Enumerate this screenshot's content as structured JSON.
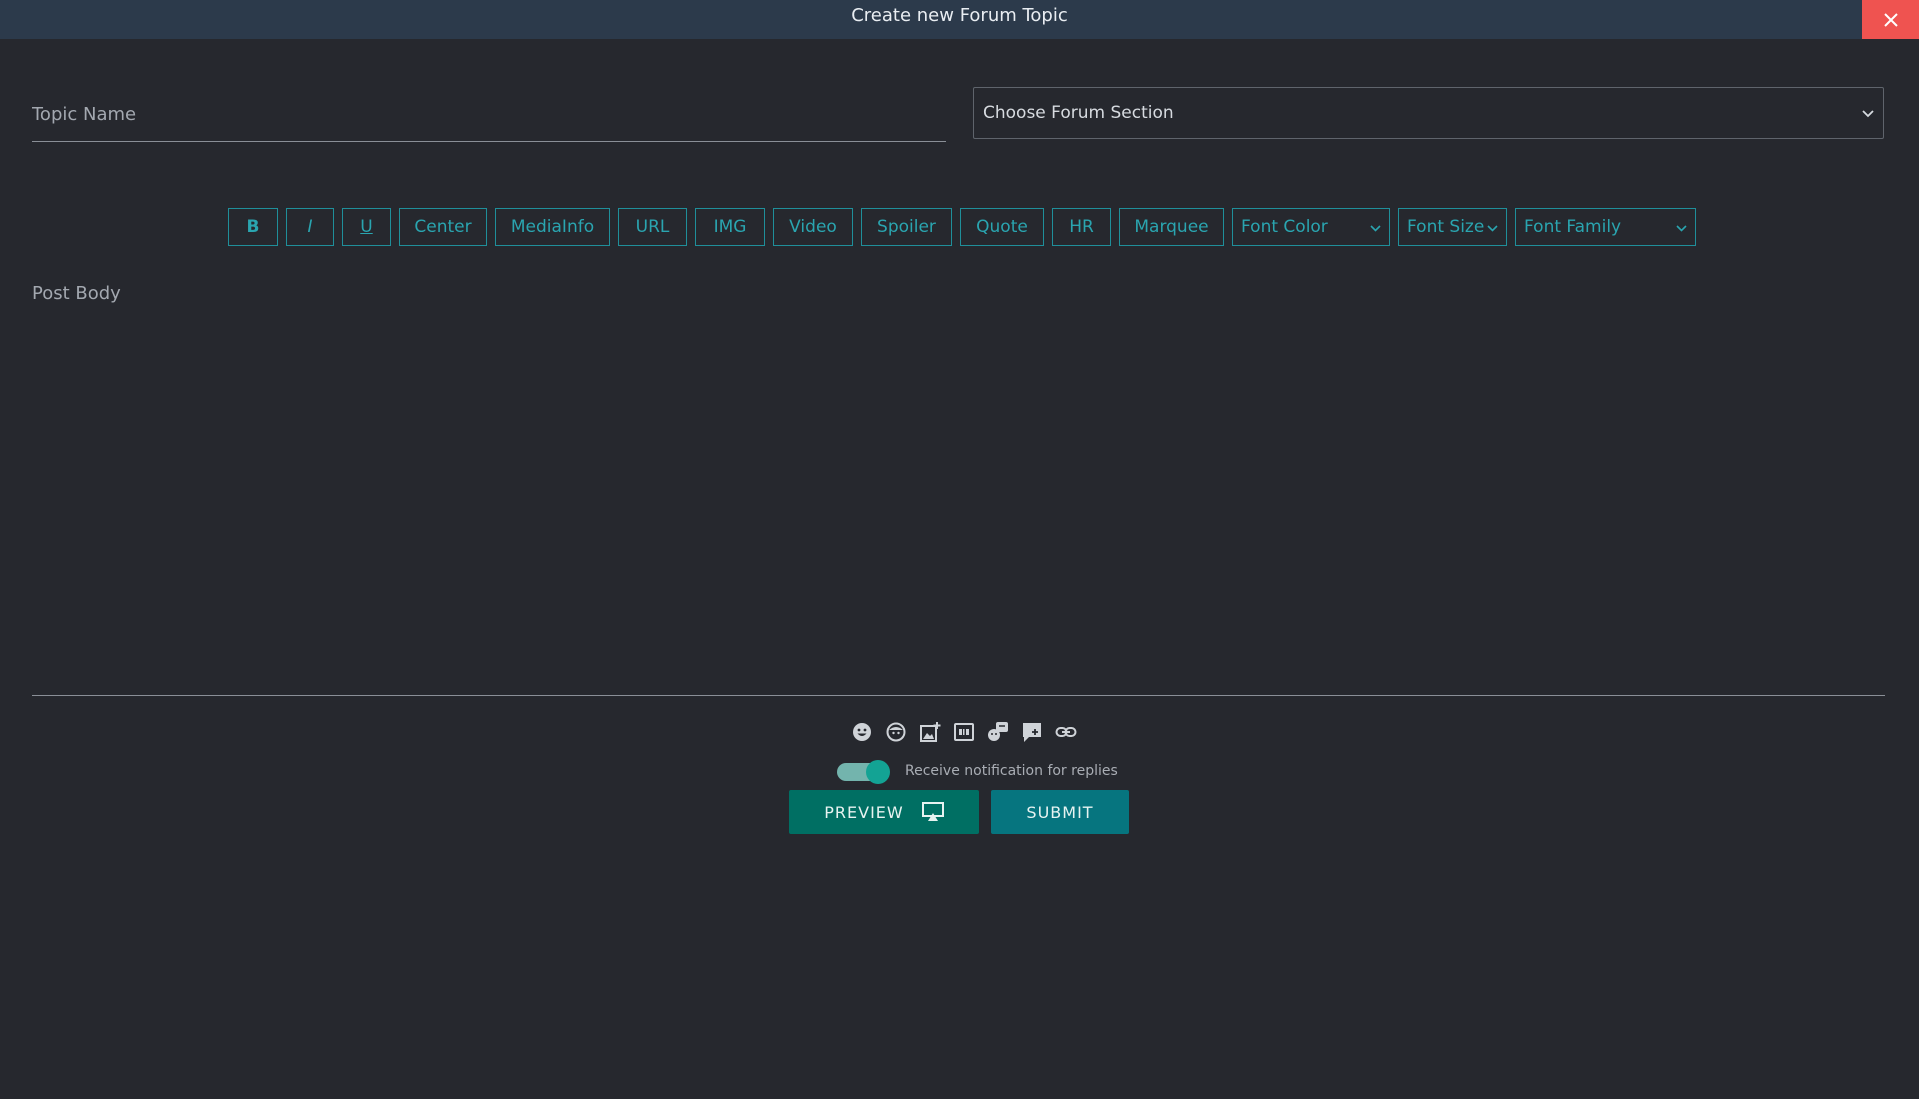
{
  "dialog": {
    "title": "Create new Forum Topic"
  },
  "form": {
    "topic_placeholder": "Topic Name",
    "section_select": "Choose Forum Section",
    "post_body_placeholder": "Post Body"
  },
  "toolbar": {
    "bold": "B",
    "italic": "I",
    "underline": "U",
    "center": "Center",
    "mediainfo": "MediaInfo",
    "url": "URL",
    "img": "IMG",
    "video": "Video",
    "spoiler": "Spoiler",
    "quote": "Quote",
    "hr": "HR",
    "marquee": "Marquee",
    "font_color": "Font Color",
    "font_size": "Font Size",
    "font_family": "Font Family"
  },
  "icons": [
    "emoji-icon",
    "sticker-icon",
    "add-image-icon",
    "gif-icon",
    "meme-icon",
    "forum-comment-icon",
    "link-icon"
  ],
  "notify": {
    "label": "Receive notification for replies",
    "enabled": true
  },
  "actions": {
    "preview": "PREVIEW",
    "submit": "SUBMIT"
  },
  "colors": {
    "accent": "#1f8f9a",
    "close": "#ef5350",
    "preview": "#006f63",
    "submit": "#06757f"
  }
}
